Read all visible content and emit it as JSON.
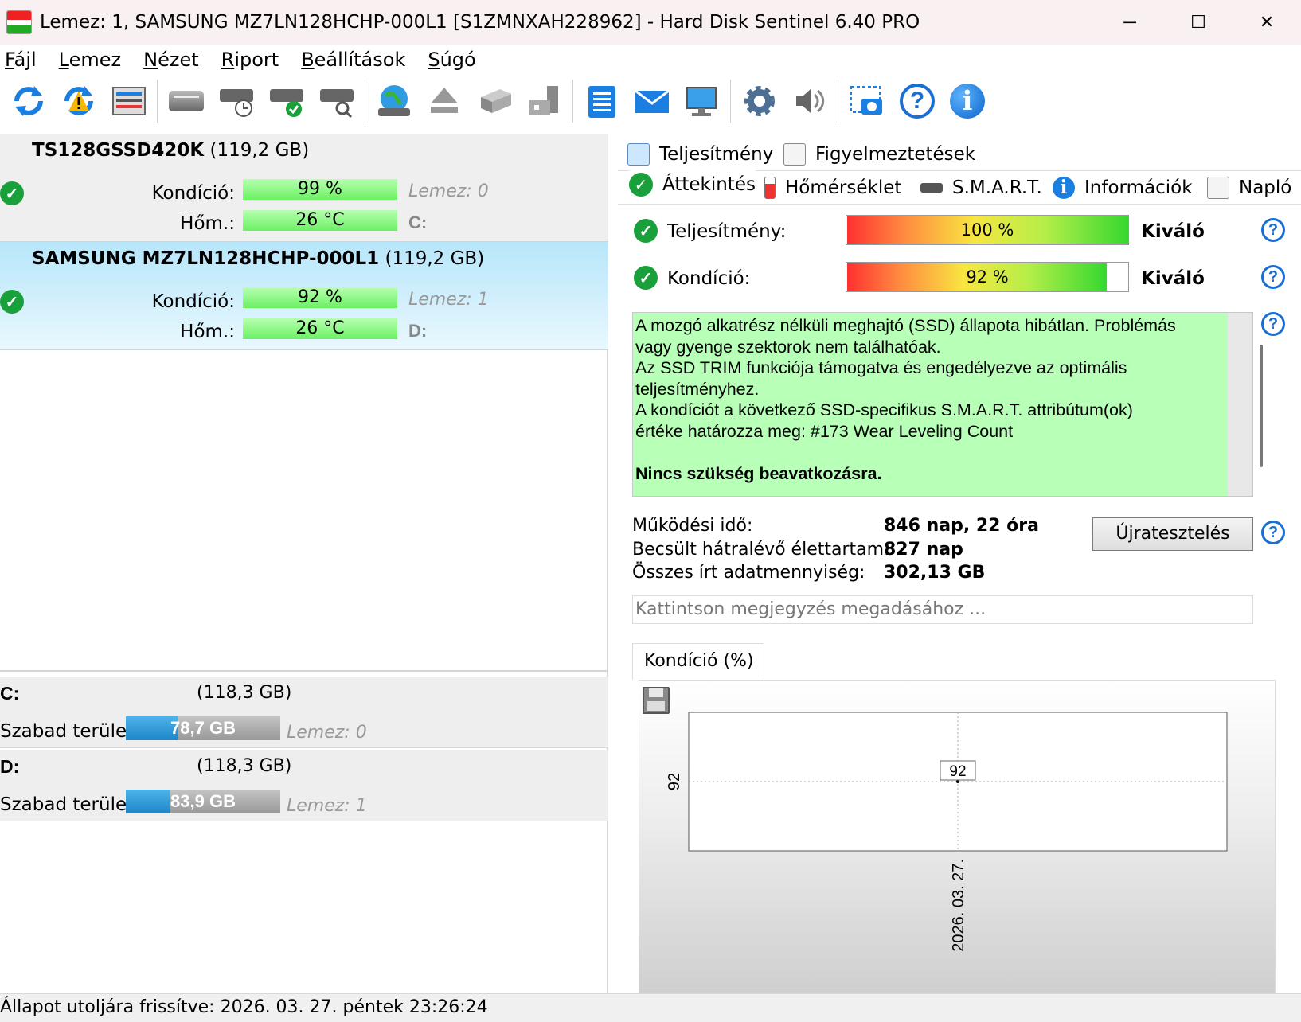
{
  "window": {
    "title": "Lemez: 1, SAMSUNG MZ7LN128HCHP-000L1 [S1ZMNXAH228962]  -  Hard Disk Sentinel 6.40 PRO",
    "controls": {
      "minimize": "─",
      "maximize": "☐",
      "close": "✕"
    }
  },
  "menu": [
    "Fájl",
    "Lemez",
    "Nézet",
    "Riport",
    "Beállítások",
    "Súgó"
  ],
  "toolbar": {
    "icons": [
      "refresh-icon",
      "refresh-warning-icon",
      "drive-list-icon",
      "disk-surface-icon",
      "disk-timer-icon",
      "disk-check-icon",
      "disk-search-icon",
      "globe-disk-icon",
      "eject-icon",
      "disk-module-icon",
      "disk-tools-icon",
      "notepad-icon",
      "mail-icon",
      "monitor-icon",
      "gear-icon",
      "speaker-icon",
      "screenshot-icon",
      "help-icon",
      "info-icon"
    ]
  },
  "disks": [
    {
      "name": "TS128GSSD420K",
      "size": "(119,2 GB)",
      "condition_label": "Kondíció:",
      "condition": "99 %",
      "disk_ref": "Lemez: 0",
      "temp_label": "Hőm.:",
      "temp": "26 °C",
      "letter": "C:"
    },
    {
      "name": "SAMSUNG MZ7LN128HCHP-000L1",
      "size": "(119,2 GB)",
      "condition_label": "Kondíció:",
      "condition": "92 %",
      "disk_ref": "Lemez: 1",
      "temp_label": "Hőm.:",
      "temp": "26 °C",
      "letter": "D:"
    }
  ],
  "volumes": [
    {
      "letter": "C:",
      "size": "(118,3 GB)",
      "free_label": "Szabad terület",
      "free": "78,7 GB",
      "used_fraction": 0.335,
      "disk_ref": "Lemez: 0"
    },
    {
      "letter": "D:",
      "size": "(118,3 GB)",
      "free_label": "Szabad terület",
      "free": "83,9 GB",
      "used_fraction": 0.29,
      "disk_ref": "Lemez: 1"
    }
  ],
  "tabs": {
    "row1": [
      "Teljesítmény",
      "Figyelmeztetések"
    ],
    "row2": [
      "Áttekintés",
      "Hőmérséklet",
      "S.M.A.R.T.",
      "Információk",
      "Napló"
    ],
    "active": "Áttekintés"
  },
  "overview": {
    "performance_label": "Teljesítmény:",
    "performance_value": "100 %",
    "performance_fraction": 1.0,
    "performance_rating": "Kiváló",
    "condition_label": "Kondíció:",
    "condition_value": "92 %",
    "condition_fraction": 0.92,
    "condition_rating": "Kiváló",
    "message_lines": [
      "A mozgó alkatrész nélküli meghajtó (SSD) állapota hibátlan. Problémás",
      "vagy gyenge szektorok nem találhatóak.",
      "Az SSD TRIM funkciója támogatva és engedélyezve az optimális",
      "teljesítményhez.",
      "A kondíciót a következő SSD-specifikus S.M.A.R.T. attribútum(ok)",
      "értéke határozza meg:  #173 Wear Leveling Count"
    ],
    "message_bold": "Nincs szükség beavatkozásra.",
    "uptime_label": "Működési idő:",
    "uptime_value": "846 nap, 22 óra",
    "remaining_label": "Becsült hátralévő élettartam:",
    "remaining_value": "827 nap",
    "written_label": "Összes írt adatmennyiség:",
    "written_value": "302,13 GB",
    "retest_button": "Újratesztelés",
    "note_placeholder": "Kattintson megjegyzés megadásához ...",
    "help_glyph": "?",
    "ok_glyph": "✓"
  },
  "chart_data": {
    "type": "line",
    "tab_label": "Kondíció  (%)",
    "x": [
      "2026. 03. 27."
    ],
    "series": [
      {
        "values": [
          92
        ]
      }
    ],
    "yticks": [
      "92"
    ],
    "data_labels": [
      "92"
    ],
    "grid": true
  },
  "status": {
    "text": "Állapot utoljára frissítve: 2026. 03. 27. péntek 23:26:24"
  }
}
